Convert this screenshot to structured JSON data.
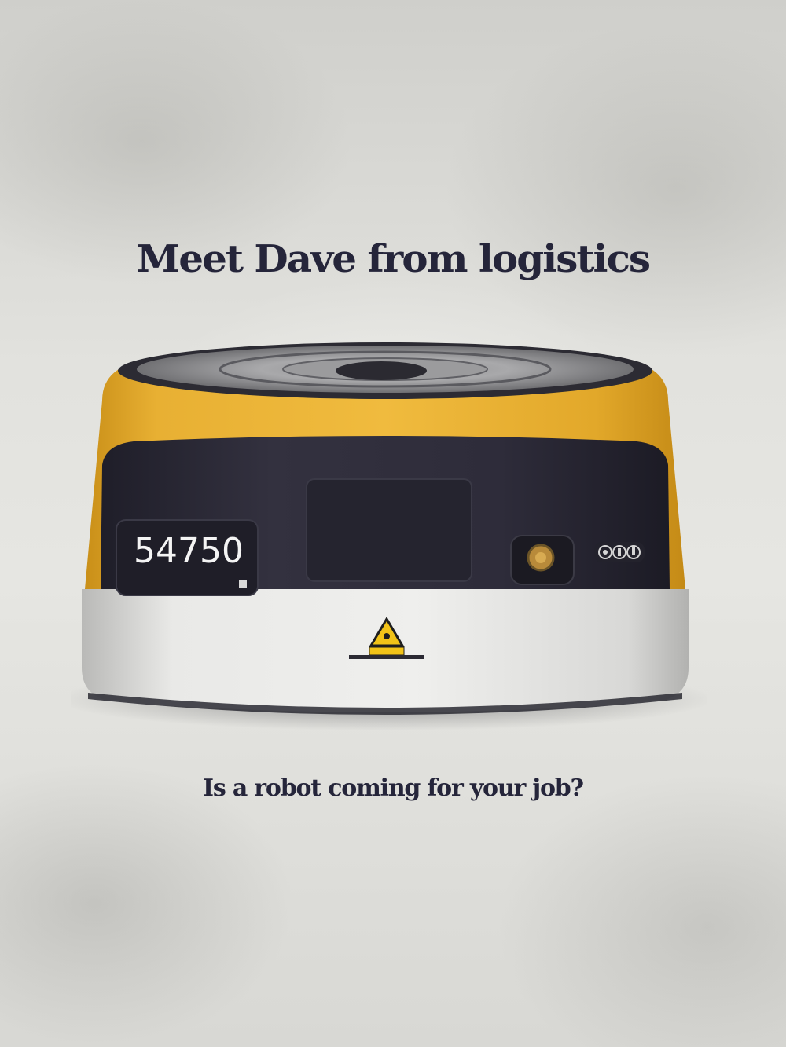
{
  "headline": "Meet Dave from logistics",
  "subheadline": "Is a robot coming for your job?",
  "robot": {
    "id_number": "54750",
    "body_color": "#e6ad2c",
    "panel_color": "#2f2d3a",
    "base_color": "#e4e4e2"
  },
  "icons": {
    "warning": "laser-warning-icon",
    "button": "power-button-icon",
    "status": "status-lights-icon"
  }
}
